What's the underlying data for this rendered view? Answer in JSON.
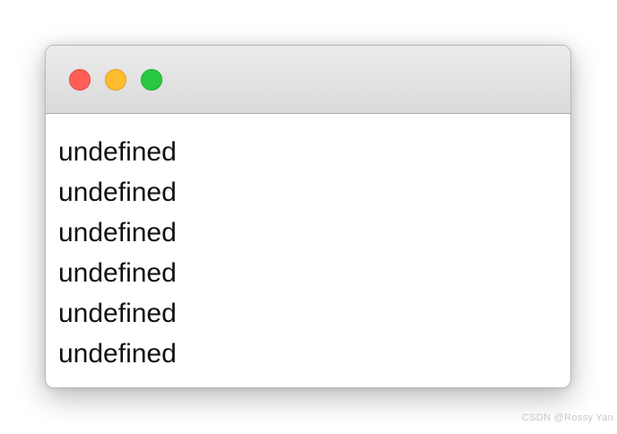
{
  "window": {
    "controls": {
      "close": {
        "icon": "close-dot-icon",
        "color": "#ff5f57"
      },
      "minimize": {
        "icon": "minimize-dot-icon",
        "color": "#febc2e"
      },
      "zoom": {
        "icon": "zoom-dot-icon",
        "color": "#28c840"
      }
    },
    "lines": [
      "undefined",
      "undefined",
      "undefined",
      "undefined",
      "undefined",
      "undefined"
    ]
  },
  "watermark": "CSDN @Rossy Yan"
}
